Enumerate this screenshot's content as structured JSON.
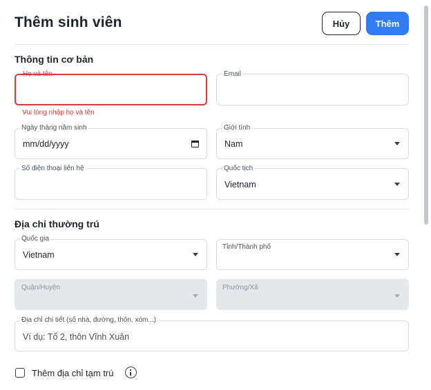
{
  "dialog": {
    "title": "Thêm sinh viên",
    "cancel_label": "Hủy",
    "submit_label": "Thêm"
  },
  "basic_info": {
    "section_title": "Thông tin cơ bản",
    "full_name": {
      "label": "Họ và tên",
      "value": "",
      "error": "Vui lòng nhập họ và tên"
    },
    "email": {
      "label": "Email",
      "value": ""
    },
    "dob": {
      "label": "Ngày tháng năm sinh",
      "placeholder": "mm/dd/yyyy"
    },
    "gender": {
      "label": "Giới tính",
      "value": "Nam"
    },
    "phone": {
      "label": "Số điện thoại liên hệ",
      "value": ""
    },
    "nationality": {
      "label": "Quốc tịch",
      "value": "Vietnam"
    }
  },
  "permanent_address": {
    "section_title": "Địa chỉ thường trú",
    "country": {
      "label": "Quốc gia",
      "value": "Vietnam"
    },
    "province": {
      "label": "Tỉnh/Thành phố",
      "value": ""
    },
    "district": {
      "label": "Quận/Huyện",
      "value": ""
    },
    "ward": {
      "label": "Phường/Xã",
      "value": ""
    },
    "detail": {
      "label": "Địa chỉ chi tiết (số nhà, đường, thôn, xóm...)",
      "placeholder": "Ví dụ: Tổ 2, thôn Vĩnh Xuân"
    }
  },
  "temp_address": {
    "checkbox_label": "Thêm địa chỉ tạm trú",
    "checked": false
  },
  "colors": {
    "primary": "#2f7cf6",
    "error": "#d93a3a",
    "disabled_bg": "#e5e7eb"
  },
  "icons": [
    "calendar-icon",
    "chevron-down-icon",
    "info-icon",
    "checkbox-icon"
  ]
}
